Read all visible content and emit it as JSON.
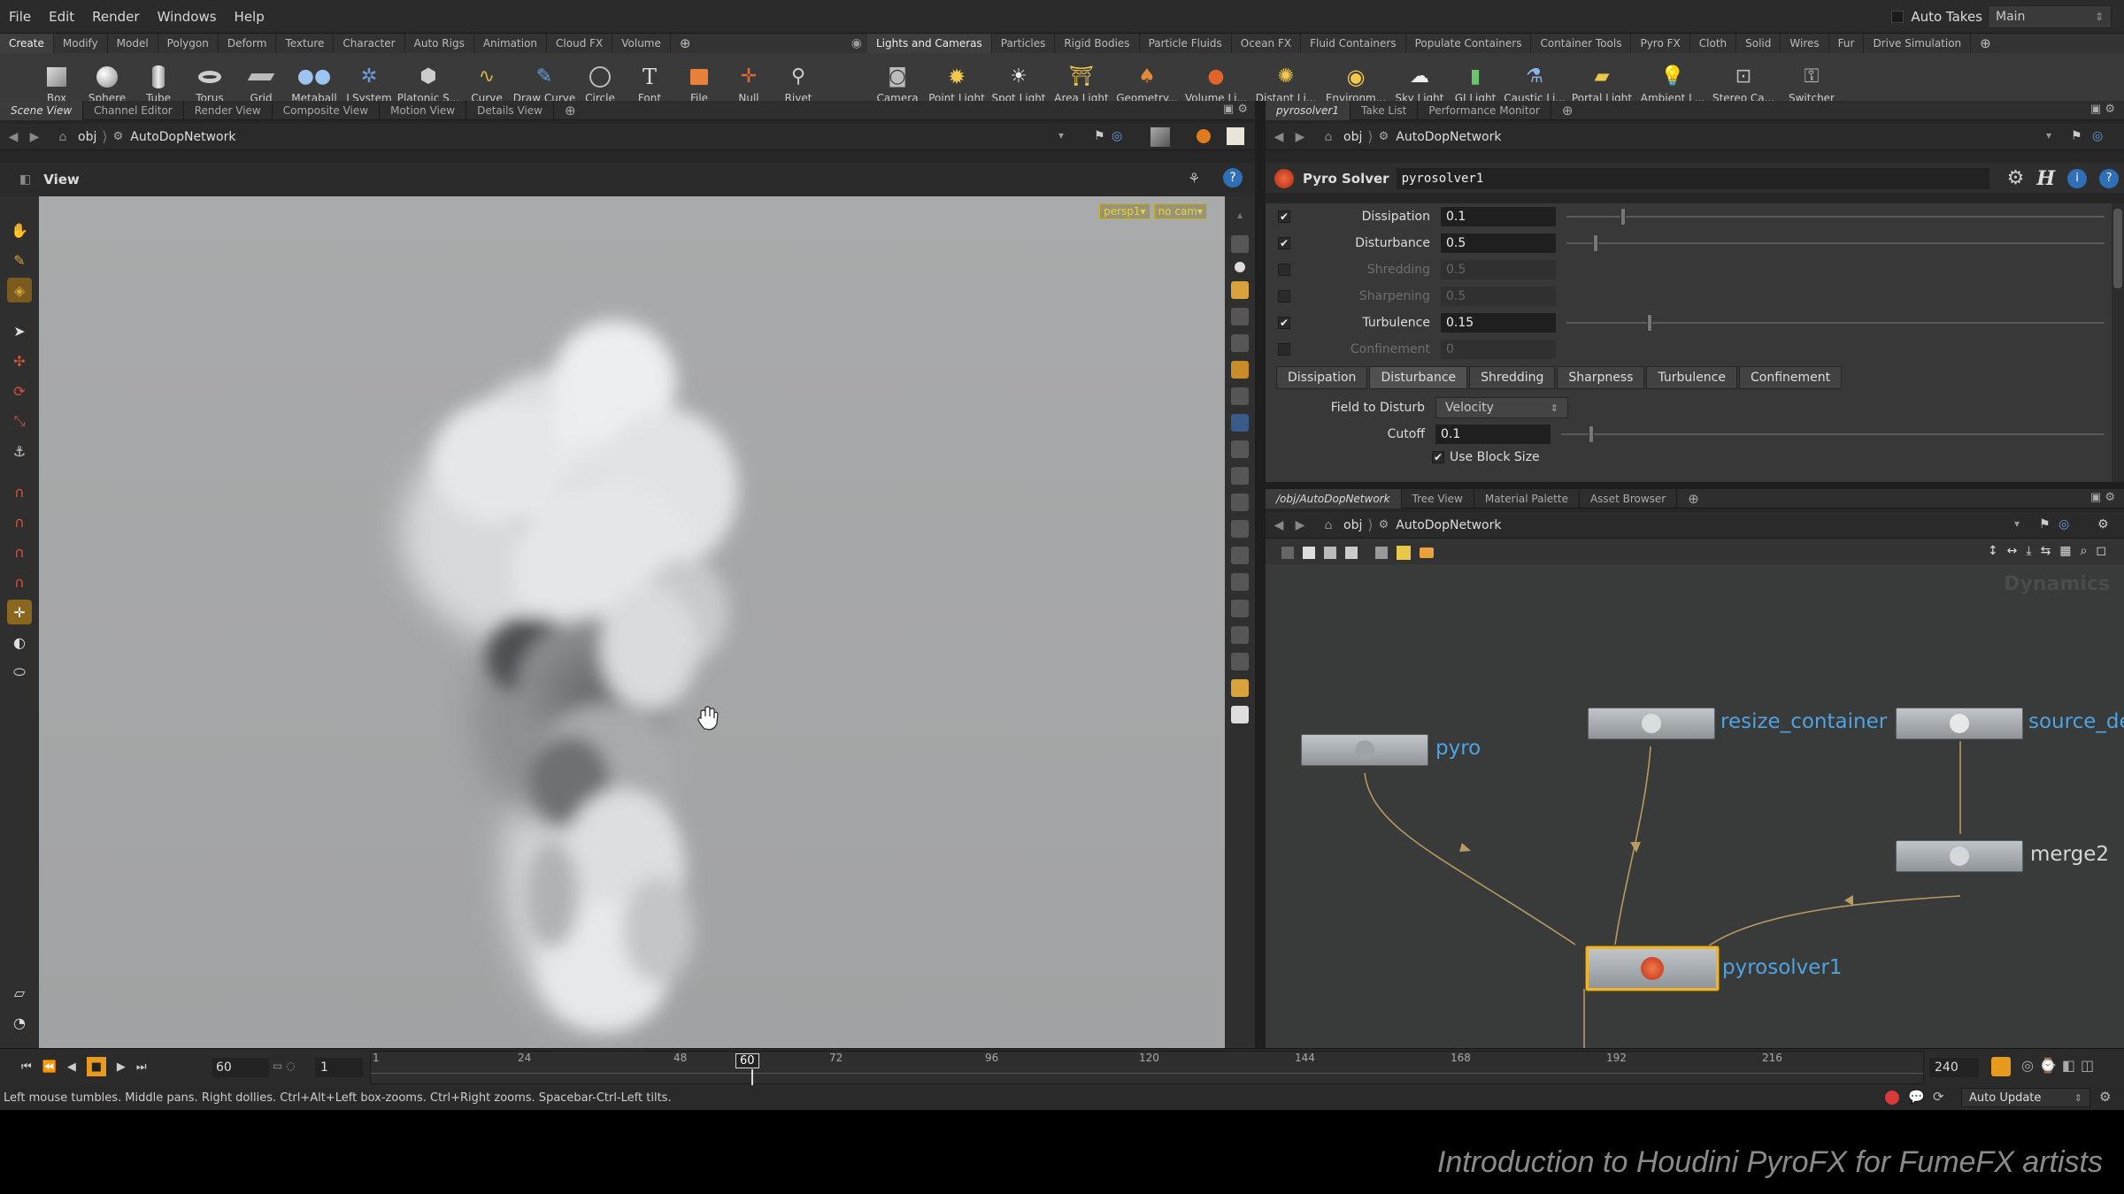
{
  "menubar": {
    "items": [
      "File",
      "Edit",
      "Render",
      "Windows",
      "Help"
    ],
    "auto_takes": "Auto Takes",
    "desktop": "Main"
  },
  "shelf_left": {
    "tabs": [
      "Create",
      "Modify",
      "Model",
      "Polygon",
      "Deform",
      "Texture",
      "Character",
      "Auto Rigs",
      "Animation",
      "Cloud FX",
      "Volume"
    ],
    "tools": [
      "Box",
      "Sphere",
      "Tube",
      "Torus",
      "Grid",
      "Metaball",
      "LSystem",
      "Platonic S...",
      "Curve",
      "Draw Curve",
      "Circle",
      "Font",
      "File",
      "Null",
      "Rivet"
    ]
  },
  "shelf_right": {
    "tabs": [
      "Lights and Cameras",
      "Particles",
      "Rigid Bodies",
      "Particle Fluids",
      "Ocean FX",
      "Fluid Containers",
      "Populate Containers",
      "Container Tools",
      "Pyro FX",
      "Cloth",
      "Solid",
      "Wires",
      "Fur",
      "Drive Simulation"
    ],
    "tools": [
      "Camera",
      "Point Light",
      "Spot Light",
      "Area Light",
      "Geometry...",
      "Volume Li...",
      "Distant Li...",
      "Environm...",
      "Sky Light",
      "GI Light",
      "Caustic Li...",
      "Portal Light",
      "Ambient L...",
      "Stereo Ca...",
      "Switcher"
    ]
  },
  "left_pane": {
    "tabs": [
      "Scene View",
      "Channel Editor",
      "Render View",
      "Composite View",
      "Motion View",
      "Details View"
    ],
    "path": [
      "obj",
      "AutoDopNetwork"
    ],
    "view_title": "View",
    "cam_badges": [
      "persp1▾",
      "no cam▾"
    ]
  },
  "param_pane": {
    "tabs": [
      "pyrosolver1",
      "Take List",
      "Performance Monitor"
    ],
    "path": [
      "obj",
      "AutoDopNetwork"
    ],
    "node_type": "Pyro Solver",
    "node_name": "pyrosolver1",
    "params": [
      {
        "label": "Dissipation",
        "value": "0.1",
        "checked": true,
        "enabled": true,
        "pos": 0.25
      },
      {
        "label": "Disturbance",
        "value": "0.5",
        "checked": true,
        "enabled": true,
        "pos": 0.27
      },
      {
        "label": "Shredding",
        "value": "0.5",
        "checked": false,
        "enabled": false,
        "pos": null
      },
      {
        "label": "Sharpening",
        "value": "0.5",
        "checked": false,
        "enabled": false,
        "pos": null
      },
      {
        "label": "Turbulence",
        "value": "0.15",
        "checked": true,
        "enabled": true,
        "pos": 0.21
      },
      {
        "label": "Confinement",
        "value": "0",
        "checked": false,
        "enabled": false,
        "pos": null
      }
    ],
    "subtabs": [
      "Dissipation",
      "Disturbance",
      "Shredding",
      "Sharpness",
      "Turbulence",
      "Confinement"
    ],
    "field_to_disturb_label": "Field to Disturb",
    "field_to_disturb": "Velocity",
    "cutoff_label": "Cutoff",
    "cutoff": "0.1",
    "use_block_size": "Use Block Size"
  },
  "network_pane": {
    "tabs": [
      "/obj/AutoDopNetwork",
      "Tree View",
      "Material Palette",
      "Asset Browser"
    ],
    "path": [
      "obj",
      "AutoDopNetwork"
    ],
    "watermark": "Dynamics",
    "nodes": [
      "pyro",
      "resize_container",
      "source_de",
      "merge2",
      "pyrosolver1"
    ]
  },
  "timeline": {
    "current_frame": "60",
    "start_frame": "1",
    "end_frame": "240",
    "ticks": [
      "1",
      "24",
      "48",
      "60",
      "72",
      "96",
      "120",
      "144",
      "168",
      "192",
      "216"
    ]
  },
  "status": {
    "hint": "Left mouse tumbles. Middle pans. Right dollies. Ctrl+Alt+Left box-zooms. Ctrl+Right zooms. Spacebar-Ctrl-Left tilts.",
    "auto_update": "Auto Update"
  },
  "footer": {
    "caption": "Introduction to Houdini PyroFX for FumeFX artists"
  },
  "colors": {
    "accent_orange": "#e89a1e",
    "node_label": "#4fa3e0",
    "selected_node": "#f0b429"
  }
}
